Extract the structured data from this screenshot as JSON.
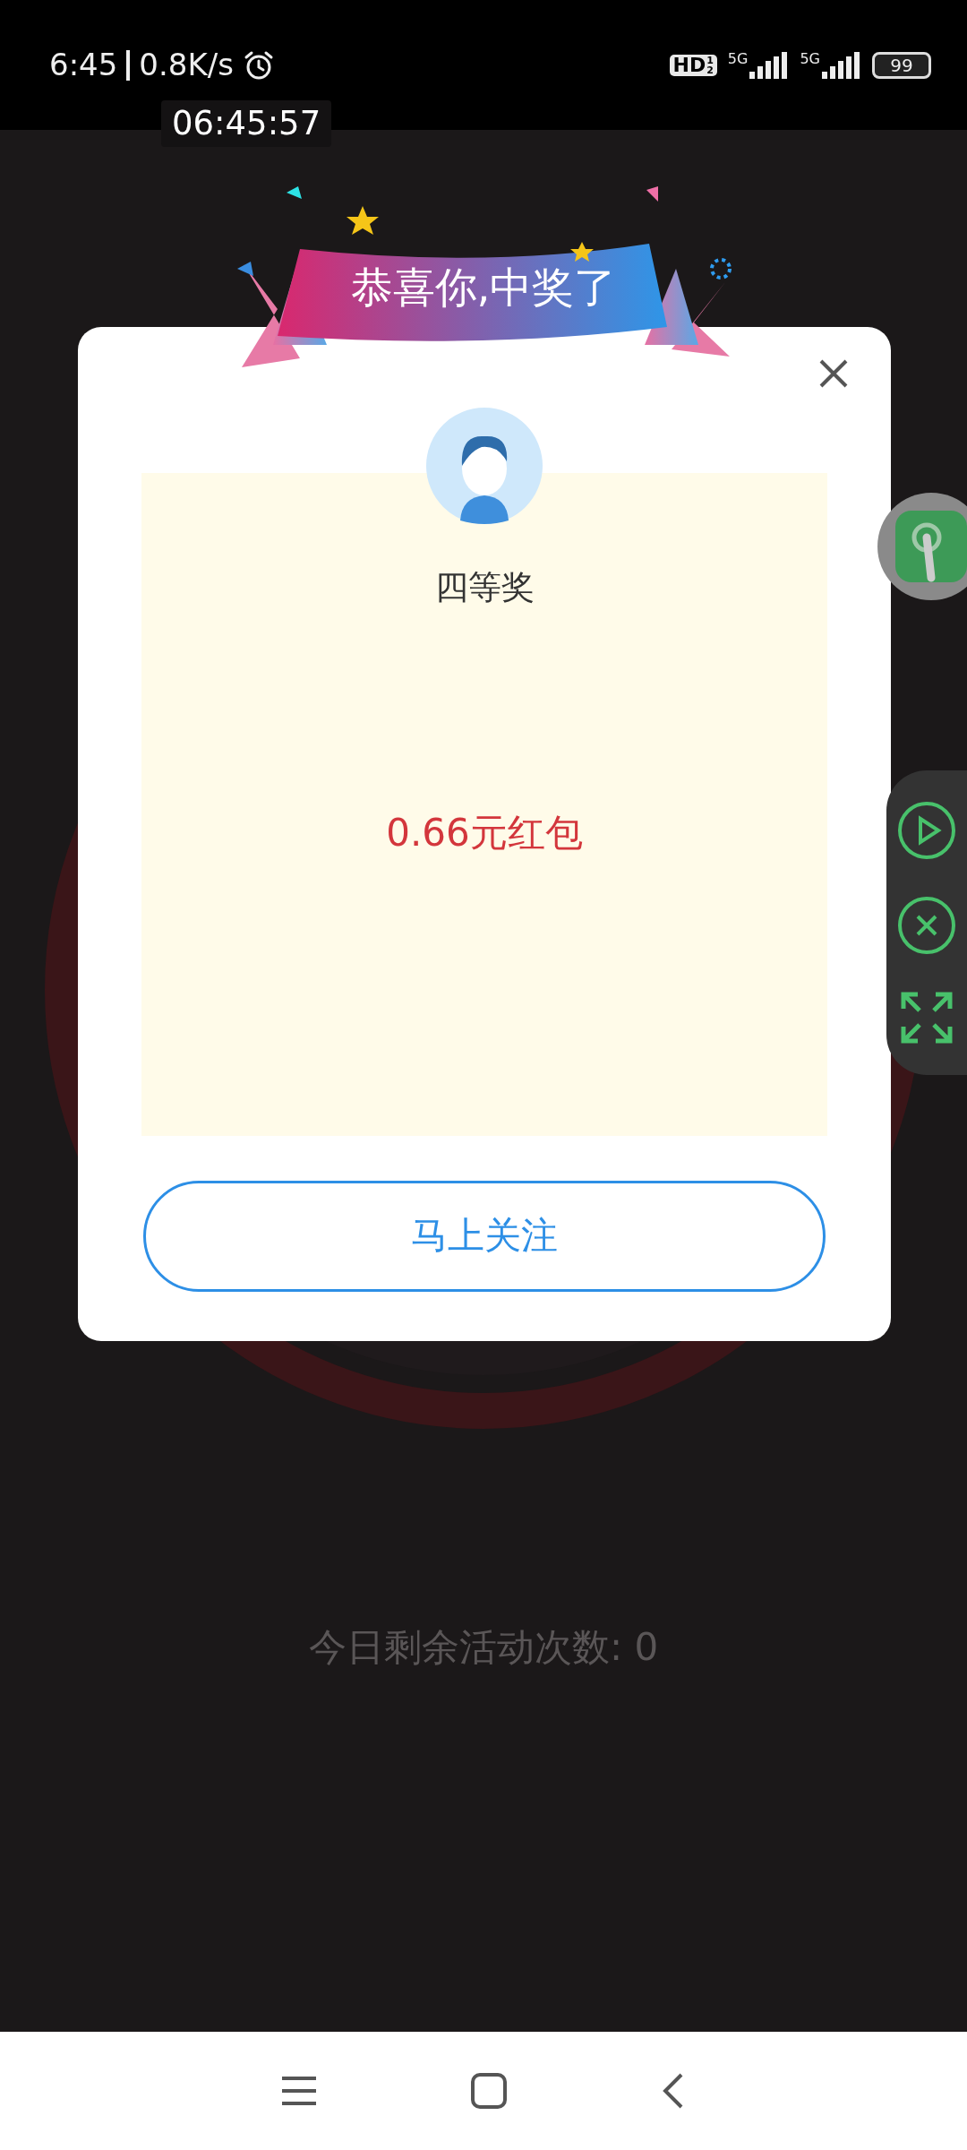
{
  "status_bar": {
    "time": "6:45",
    "speed": "0.8K/s",
    "hd": "HD",
    "hd_sup": "1",
    "hd_sub": "2",
    "networks": [
      "5G",
      "5G"
    ],
    "battery": "99"
  },
  "clock_chip": "06:45:57",
  "background": {
    "remaining_text": "今日剩余活动次数: 0"
  },
  "dialog": {
    "banner": "恭喜你,中奖了",
    "prize_level": "四等奖",
    "prize": "0.66元红包",
    "button": "马上关注"
  }
}
